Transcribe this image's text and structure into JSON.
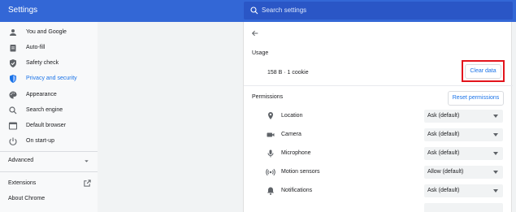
{
  "header": {
    "title": "Settings",
    "search_placeholder": "Search settings"
  },
  "sidebar": {
    "items": [
      {
        "label": "You and Google",
        "icon": "person-icon"
      },
      {
        "label": "Auto-fill",
        "icon": "clipboard-icon"
      },
      {
        "label": "Safety check",
        "icon": "shield-check-icon"
      },
      {
        "label": "Privacy and security",
        "icon": "shield-icon",
        "active": true
      },
      {
        "label": "Appearance",
        "icon": "palette-icon"
      },
      {
        "label": "Search engine",
        "icon": "search-icon"
      },
      {
        "label": "Default browser",
        "icon": "browser-icon"
      },
      {
        "label": "On start-up",
        "icon": "power-icon"
      }
    ],
    "advanced": "Advanced",
    "extensions": "Extensions",
    "about": "About Chrome"
  },
  "content": {
    "usage_title": "Usage",
    "usage_value": "158 B · 1 cookie",
    "clear_data": "Clear data",
    "permissions_title": "Permissions",
    "reset_permissions": "Reset permissions",
    "permissions": [
      {
        "label": "Location",
        "value": "Ask (default)",
        "icon": "location-icon"
      },
      {
        "label": "Camera",
        "value": "Ask (default)",
        "icon": "camera-icon"
      },
      {
        "label": "Microphone",
        "value": "Ask (default)",
        "icon": "microphone-icon"
      },
      {
        "label": "Motion sensors",
        "value": "Allow (default)",
        "icon": "sensors-icon"
      },
      {
        "label": "Notifications",
        "value": "Ask (default)",
        "icon": "bell-icon"
      }
    ]
  },
  "colors": {
    "header": "#3367d6",
    "accent": "#1a73e8",
    "highlight": "#e3141c"
  }
}
